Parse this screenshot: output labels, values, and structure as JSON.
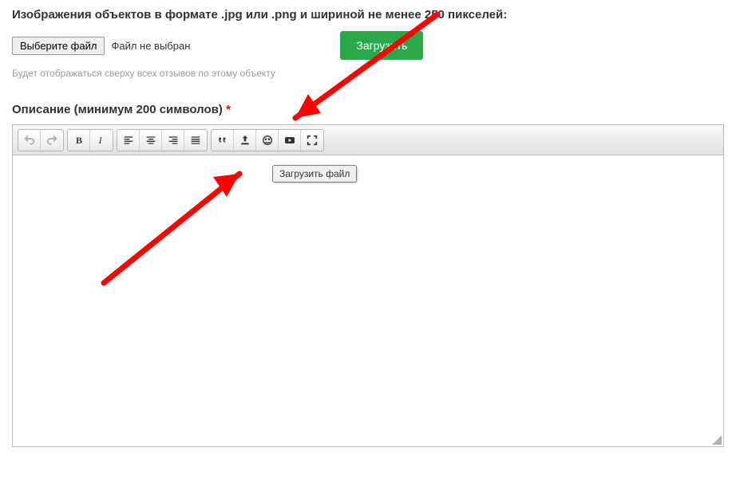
{
  "imageLabel": "Изображения объектов в формате .jpg или .png и шириной не менее 250 пикселей:",
  "fileSelectLabel": "Выберите файл",
  "fileStatus": "Файл не выбран",
  "uploadLabel": "Загрузить",
  "hint": "Будет отображаться сверху всех отзывов по этому объекту",
  "descLabel": "Описание (минимум 200 символов)",
  "required": "*",
  "tooltip": "Загрузить файл",
  "toolbar": {
    "undo": "undo",
    "redo": "redo",
    "bold": "bold",
    "italic": "italic",
    "alignLeft": "align-left",
    "alignCenter": "align-center",
    "alignRight": "align-right",
    "alignJustify": "align-justify",
    "quote": "quote",
    "upload": "upload",
    "emoji": "emoji",
    "video": "video",
    "fullscreen": "fullscreen"
  },
  "colors": {
    "uploadBtn": "#2aa94a",
    "required": "#d00",
    "arrow": "#ff0000"
  }
}
